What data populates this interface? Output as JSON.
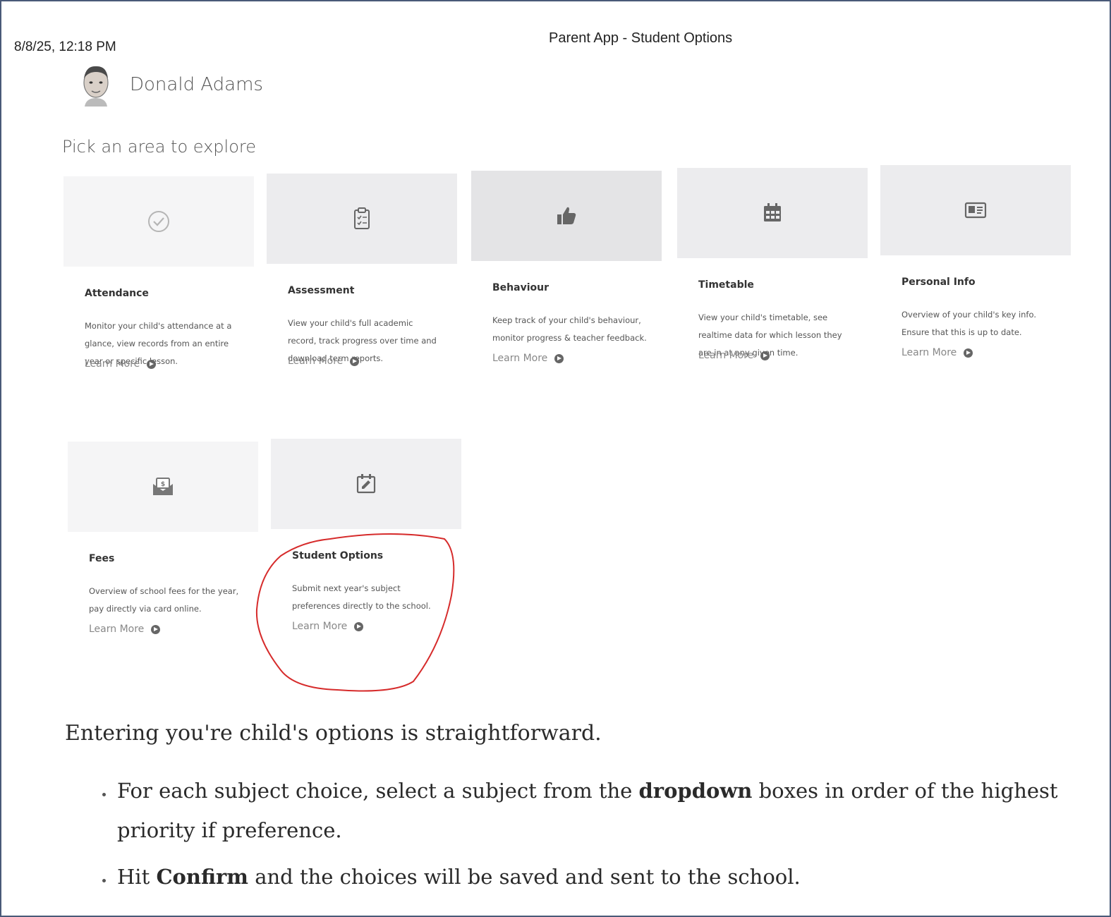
{
  "print_header": {
    "timestamp": "8/8/25, 12:18 PM",
    "page_title": "Parent App - Student Options"
  },
  "user": {
    "name": "Donald Adams"
  },
  "section_heading": "Pick an area to explore",
  "cards": [
    {
      "title": "Attendance",
      "description": "Monitor your child's attendance at a glance, view records from an entire year or specific lesson.",
      "link": "Learn More",
      "icon": "check-circle-icon"
    },
    {
      "title": "Assessment",
      "description": "View your child's full academic record, track progress over time and download term reports.",
      "link": "Learn More",
      "icon": "clipboard-icon"
    },
    {
      "title": "Behaviour",
      "description": "Keep track of your child's behaviour, monitor progress & teacher feedback.",
      "link": "Learn More",
      "icon": "thumbs-up-icon"
    },
    {
      "title": "Timetable",
      "description": "View your child's timetable, see realtime data for which lesson they are in at any given time.",
      "link": "Learn More",
      "icon": "calendar-icon"
    },
    {
      "title": "Personal Info",
      "description": "Overview of your child's key info. Ensure that this is up to date.",
      "link": "Learn More",
      "icon": "id-card-icon"
    },
    {
      "title": "Fees",
      "description": "Overview of school fees for the year, pay directly via card online.",
      "link": "Learn More",
      "icon": "money-envelope-icon"
    },
    {
      "title": "Student Options",
      "description": "Submit next year's subject preferences directly to the school.",
      "link": "Learn More",
      "icon": "edit-calendar-icon"
    }
  ],
  "instructions": {
    "intro": "Entering you're child's options is straightforward.",
    "bullets": [
      {
        "before": "For each subject choice, select a subject from the ",
        "bold": "dropdown",
        "after": " boxes in order of the highest priority if preference."
      },
      {
        "before": "Hit ",
        "bold": "Confirm",
        "after": " and the choices will be saved and sent to the school."
      }
    ]
  },
  "colors": {
    "frame_border": "#4a5a78",
    "highlight_circle": "#d62b2b",
    "card_image_bg": "#ececee"
  }
}
